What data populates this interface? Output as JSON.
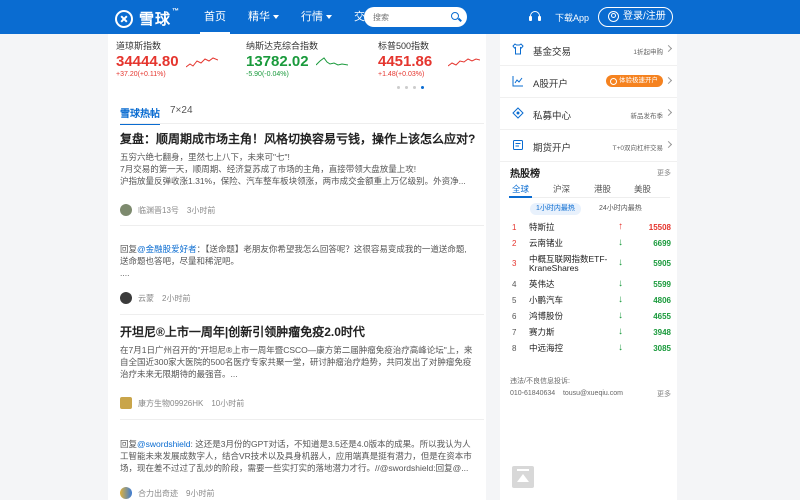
{
  "header": {
    "logo_text": "雪球",
    "logo_tm": "™",
    "nav": [
      {
        "label": "首页",
        "active": true,
        "dropdown": false
      },
      {
        "label": "精华",
        "active": false,
        "dropdown": true
      },
      {
        "label": "行情",
        "active": false,
        "dropdown": true
      },
      {
        "label": "交易",
        "active": false,
        "dropdown": true
      }
    ],
    "search_placeholder": "搜索",
    "download_label": "下载App",
    "login_label": "登录/注册",
    "brand_color": "#0a6cd1"
  },
  "indices": [
    {
      "name": "道琼斯指数",
      "value": "34444.80",
      "change": "+37.20(+0.11%)",
      "direction": "up"
    },
    {
      "name": "纳斯达克综合指数",
      "value": "13782.02",
      "change": "-5.90(-0.04%)",
      "direction": "down"
    },
    {
      "name": "标普500指数",
      "value": "4451.86",
      "change": "+1.48(+0.03%)",
      "direction": "up"
    }
  ],
  "feed_tabs": {
    "hot": "雪球热帖",
    "live": "7×24"
  },
  "posts": [
    {
      "title": "复盘：顺周期成市场主角！风格切换容易亏钱，操作上该怎么应对?",
      "body_lines": [
        "五穷六绝七翻身，里然七上八下，未来可\"七\"!",
        "7月交易的第一天，顺周期、经济复苏成了市场的主角，直接带领大盘放量上攻!",
        "沪指放量反弹收涨1.31%，保险、汽车整车板块领涨，两市成交金额重上万亿级别。外资净..."
      ],
      "author": "临渊晋13号",
      "time": "3小时前"
    },
    {
      "title": "",
      "reply_prefix": "回复",
      "mention": "@金融股爱好者",
      "body_lines": [
        "：【送命题】老朋友你希望我怎么回答呢？这很容易变成我的一道送命题,",
        "送命题也答吧，尽量和稀泥吧。",
        "...."
      ],
      "author": "云蒙",
      "time": "2小时前"
    },
    {
      "title": "开坦尼®上市一周年|创新引领肿瘤免疫2.0时代",
      "body_lines": [
        "在7月1日广州召开的\"开坦尼®上市一周年暨CSCO—康方第二届肿瘤免疫治疗高峰论坛\"上，来",
        "自全国近300家大医院的500名医疗专家共聚一堂，研讨肿瘤治疗趋势，共同发出了对肿瘤免疫",
        "治疗未来无限期待的最强音。..."
      ],
      "author": "康方生物09926HK",
      "time": "10小时前"
    },
    {
      "title": "",
      "reply_prefix": "回复",
      "mention": "@swordshield",
      "body_lines": [
        ": 这还是3月份的GPT对话，不知道是3.5还是4.0版本的成果。所以我认为人",
        "工智能未来发展成数字人，结合VR技术以及具身机器人，应用端真是挺有潜力，但是在资本市",
        "场，现在差不过过了乱炒的阶段，需要一些实打实的落地潜力才行。//@swordshield:回复@..."
      ],
      "author": "合力出奇迹",
      "time": "9小时前"
    }
  ],
  "services": [
    {
      "name": "基金交易",
      "desc": "1折起申购",
      "icon": "shirt-icon"
    },
    {
      "name": "A股开户",
      "badge": "体验极速开户",
      "icon": "chart-icon"
    },
    {
      "name": "私募中心",
      "desc": "新品发布季",
      "icon": "private-fund-icon"
    },
    {
      "name": "期货开户",
      "desc": "T+0双向杠杆交易",
      "icon": "futures-icon"
    }
  ],
  "hot_list": {
    "title": "热股榜",
    "more": "更多",
    "markets": [
      "全球",
      "沪深",
      "港股",
      "美股"
    ],
    "active_market": "全球",
    "ranges": [
      "1小时内最热",
      "24小时内最热"
    ],
    "rows": [
      {
        "rank": "1",
        "name": "特斯拉",
        "arrow": "↑",
        "direction": "up",
        "value": "15508"
      },
      {
        "rank": "2",
        "name": "云南锗业",
        "arrow": "↓",
        "direction": "down",
        "value": "6699"
      },
      {
        "rank": "3",
        "name": "中概互联网指数ETF-KraneShares",
        "arrow": "↓",
        "direction": "down",
        "value": "5905"
      },
      {
        "rank": "4",
        "name": "英伟达",
        "arrow": "↓",
        "direction": "down",
        "value": "5599"
      },
      {
        "rank": "5",
        "name": "小鹏汽车",
        "arrow": "↓",
        "direction": "down",
        "value": "4806"
      },
      {
        "rank": "6",
        "name": "鸿博股份",
        "arrow": "↓",
        "direction": "down",
        "value": "4655"
      },
      {
        "rank": "7",
        "name": "赛力斯",
        "arrow": "↓",
        "direction": "down",
        "value": "3948"
      },
      {
        "rank": "8",
        "name": "中远海控",
        "arrow": "↓",
        "direction": "down",
        "value": "3085"
      }
    ]
  },
  "report": {
    "label": "违法/不良信息投诉:",
    "phone": "010-61840634",
    "email": "tousu@xueqiu.com",
    "more": "更多"
  },
  "colors": {
    "up": "#e5352e",
    "down": "#1a9a3c",
    "accent": "#0a6cd1"
  }
}
